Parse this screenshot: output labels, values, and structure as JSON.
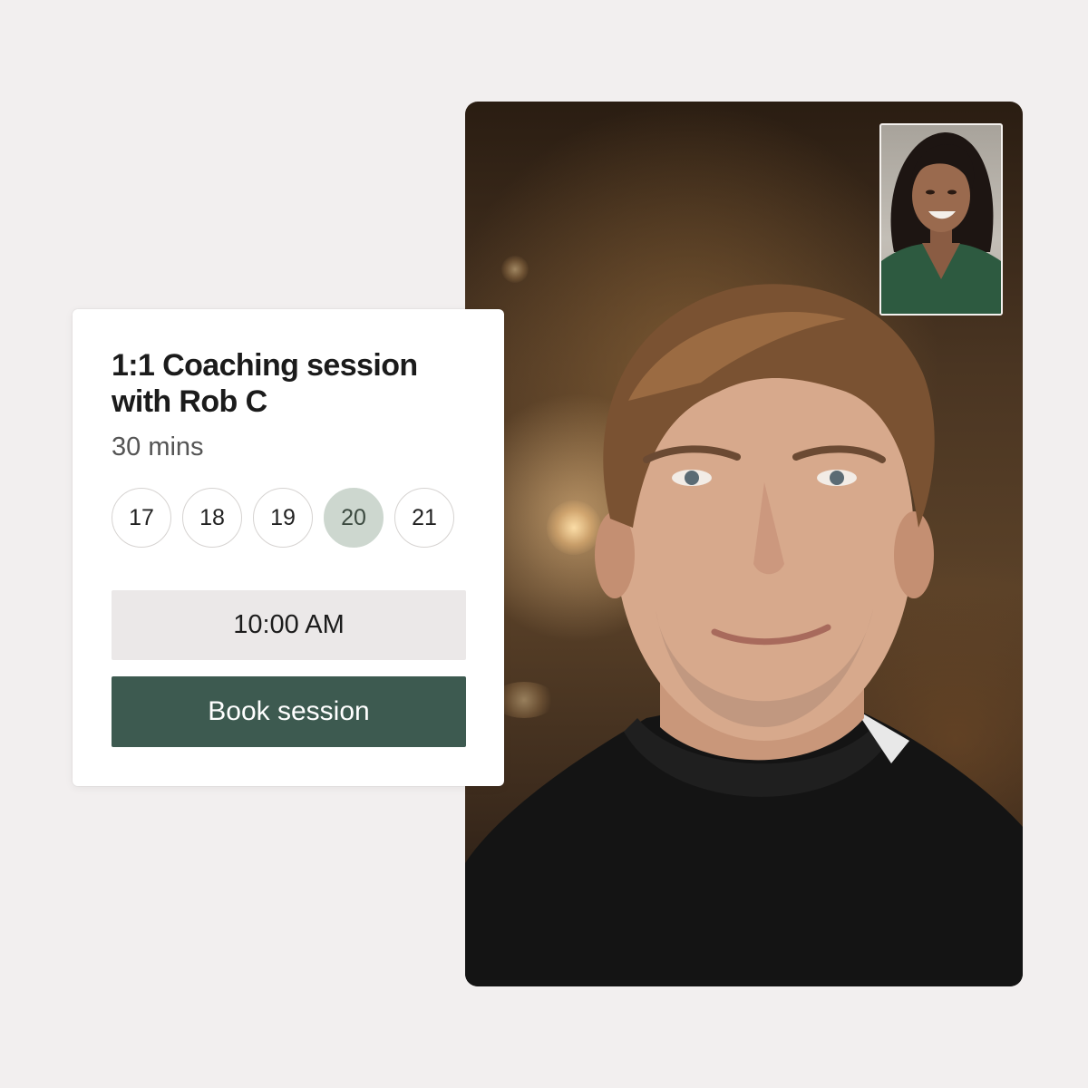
{
  "booking": {
    "title": "1:1 Coaching session with Rob C",
    "duration": "30 mins",
    "dates": [
      {
        "label": "17",
        "selected": false
      },
      {
        "label": "18",
        "selected": false
      },
      {
        "label": "19",
        "selected": false
      },
      {
        "label": "20",
        "selected": true
      },
      {
        "label": "21",
        "selected": false
      }
    ],
    "time": "10:00 AM",
    "button_label": "Book session"
  },
  "colors": {
    "page_background": "#f2efef",
    "button": "#3d5a50",
    "selected_date": "#cdd7cf",
    "time_field": "#ebe8e8"
  },
  "video_call": {
    "main_participant": "man-video-feed",
    "self_view": "woman-video-feed"
  }
}
